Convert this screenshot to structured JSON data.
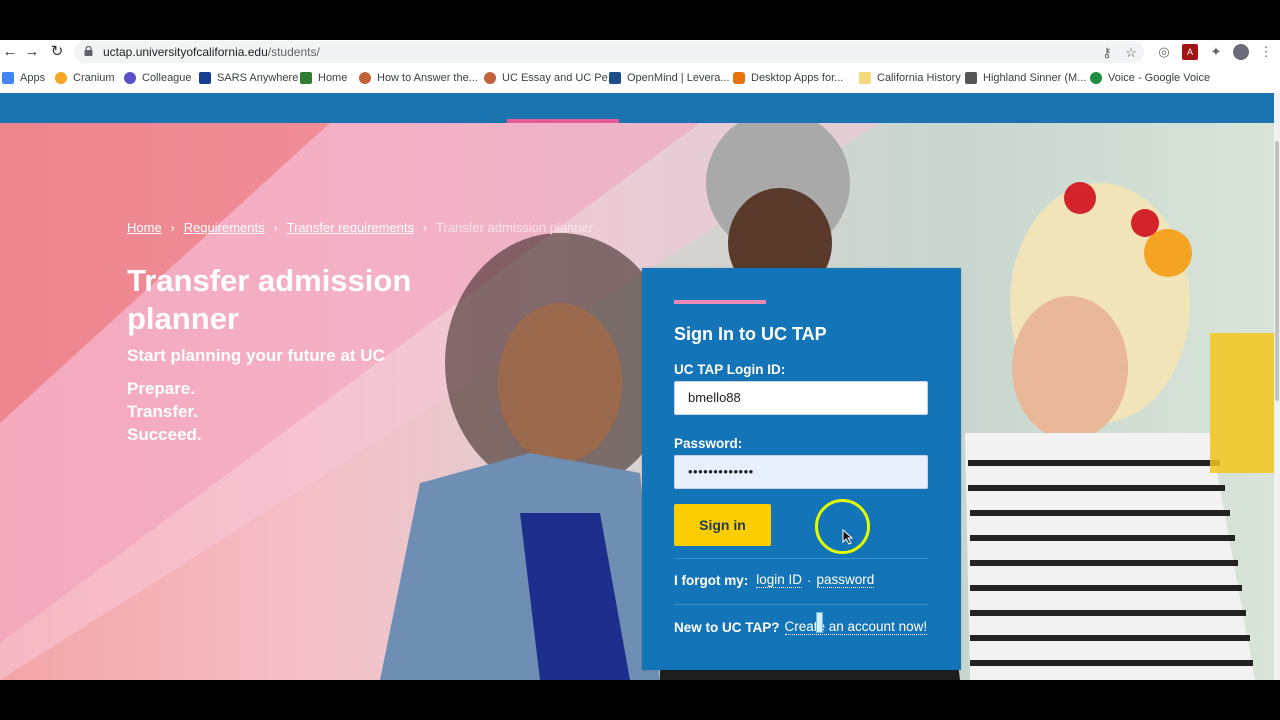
{
  "browser": {
    "url_host": "uctap.universityofcalifornia.edu",
    "url_path": "/students/",
    "bookmarks": [
      {
        "label": "Apps",
        "icon": "apps-grid-icon",
        "color": "#4285f4"
      },
      {
        "label": "Cranium",
        "icon": "cranium-icon",
        "color": "#f5a623"
      },
      {
        "label": "Colleague",
        "icon": "colleague-icon",
        "color": "#5b4fc4"
      },
      {
        "label": "SARS Anywhere",
        "icon": "sars-icon",
        "color": "#1a3d8f"
      },
      {
        "label": "Home",
        "icon": "home-icon",
        "color": "#2e7d32"
      },
      {
        "label": "How to Answer the...",
        "icon": "person-icon",
        "color": "#c0623a"
      },
      {
        "label": "UC Essay and UC Pe...",
        "icon": "person-icon",
        "color": "#c0623a"
      },
      {
        "label": "OpenMind | Levera...",
        "icon": "openmind-icon",
        "color": "#1a4f8a"
      },
      {
        "label": "Desktop Apps for...",
        "icon": "desktop-apps-icon",
        "color": "#e8710a"
      },
      {
        "label": "California History",
        "icon": "folder-icon",
        "color": "#f6d77a"
      },
      {
        "label": "Highland Sinner (M...",
        "icon": "highland-icon",
        "color": "#555555"
      },
      {
        "label": "Voice - Google Voice",
        "icon": "google-voice-icon",
        "color": "#1e8e3e"
      }
    ]
  },
  "breadcrumb": {
    "items": [
      "Home",
      "Requirements",
      "Transfer requirements"
    ],
    "current": "Transfer admission planner"
  },
  "hero": {
    "title": "Transfer admission planner",
    "subtitle": "Start planning your future at UC",
    "tagline": [
      "Prepare.",
      "Transfer.",
      "Succeed."
    ]
  },
  "signin": {
    "heading": "Sign In to UC TAP",
    "login_label": "UC TAP Login ID:",
    "login_value": "bmello88",
    "password_label": "Password:",
    "password_value": "•••••••••••••",
    "button_label": "Sign in",
    "forgot_label": "I forgot my:",
    "forgot_login": "login ID",
    "forgot_sep": "·",
    "forgot_password": "password",
    "new_label": "New to UC TAP?",
    "create_link": "Create an account now!"
  },
  "colors": {
    "brand_blue": "#1474b8",
    "accent_pink": "#e55b93",
    "button_yellow": "#fccd00"
  }
}
